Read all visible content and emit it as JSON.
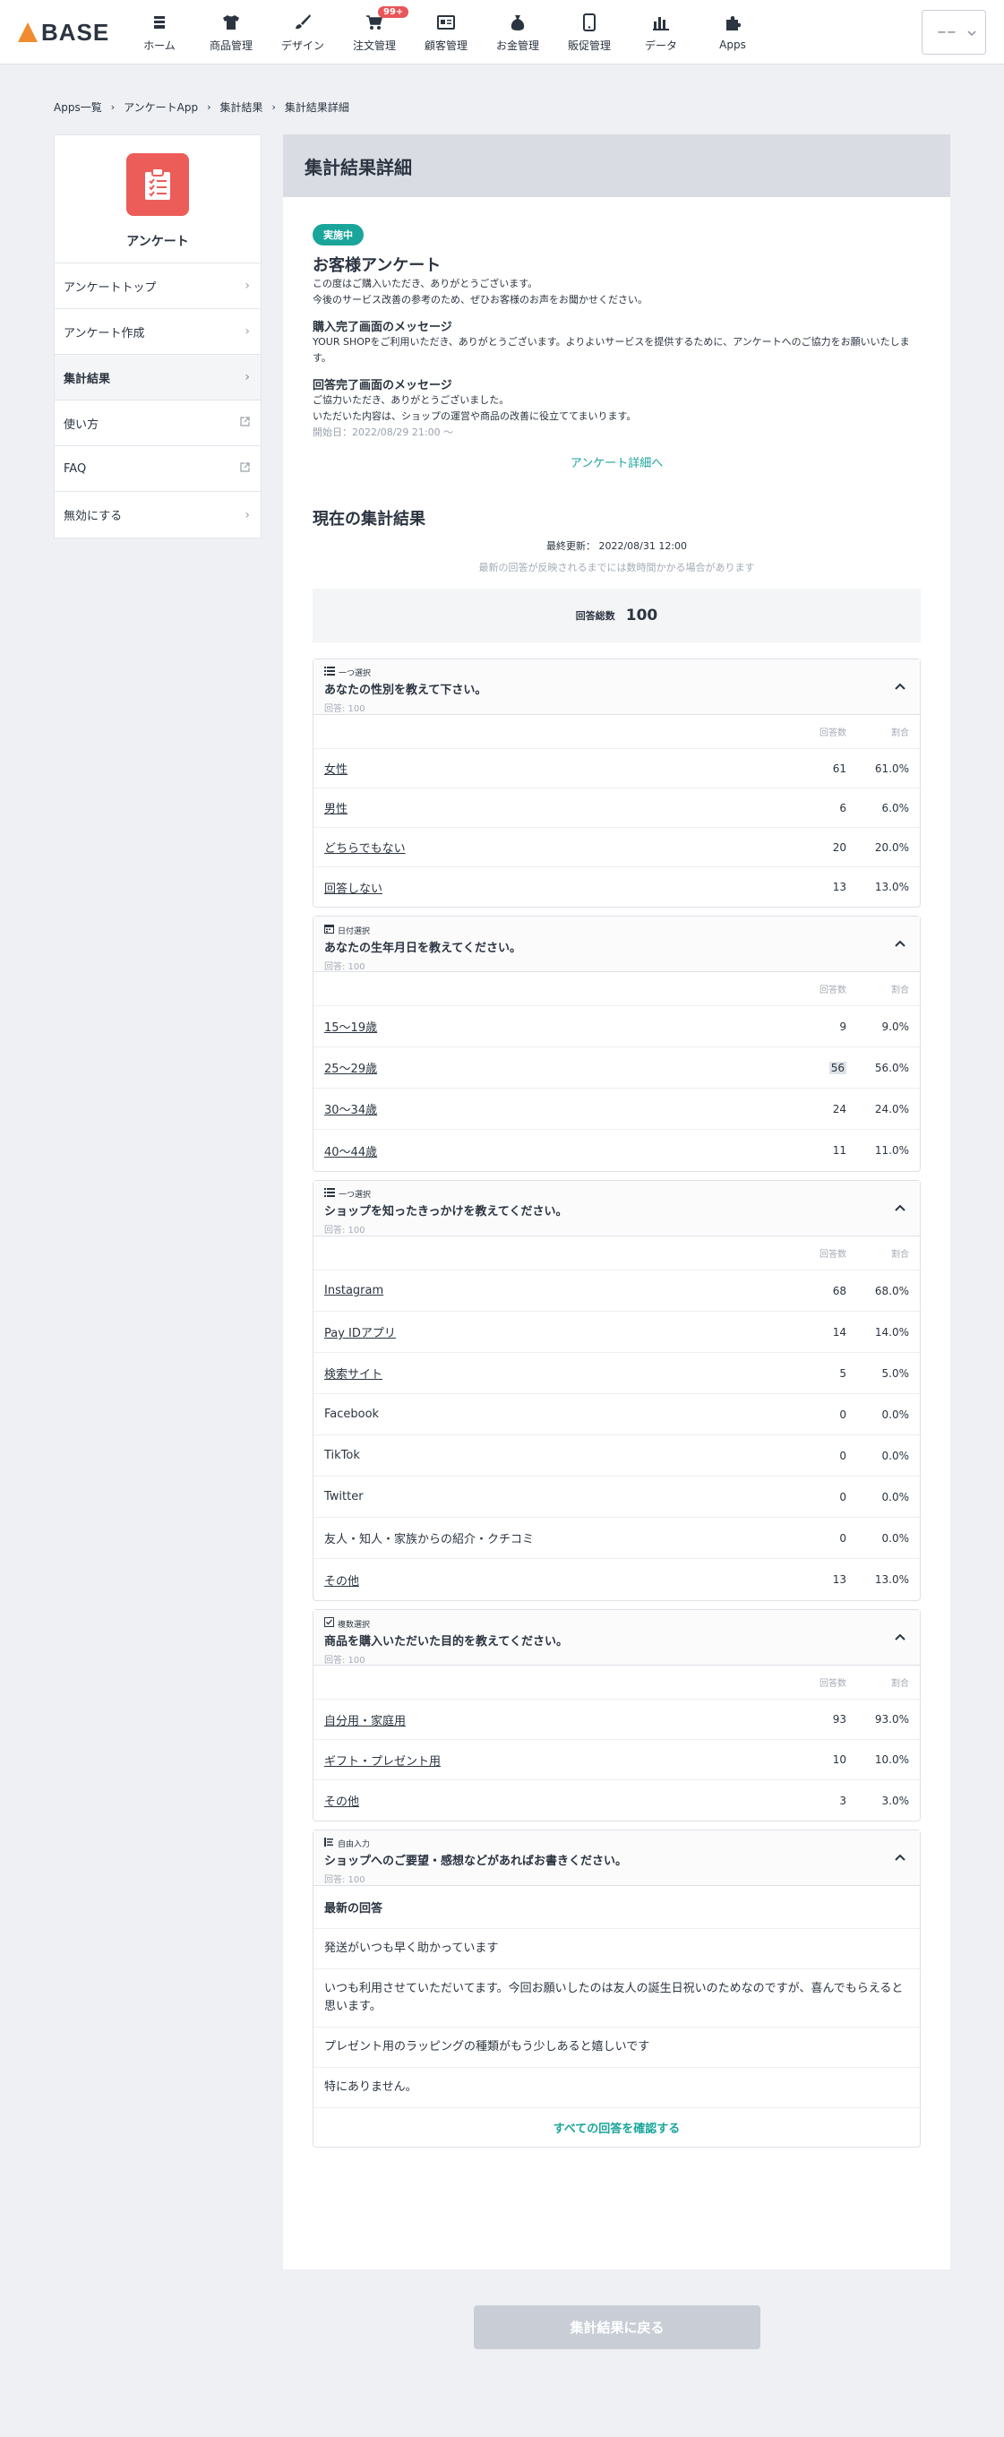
{
  "header": {
    "logo": "BASE",
    "nav": [
      {
        "label": "ホーム",
        "icon": "home-icon"
      },
      {
        "label": "商品管理",
        "icon": "shirt-icon"
      },
      {
        "label": "デザイン",
        "icon": "brush-icon"
      },
      {
        "label": "注文管理",
        "icon": "cart-icon",
        "badge": "99+"
      },
      {
        "label": "顧客管理",
        "icon": "customer-card-icon"
      },
      {
        "label": "お金管理",
        "icon": "money-bag-icon"
      },
      {
        "label": "販促管理",
        "icon": "smartphone-icon"
      },
      {
        "label": "データ",
        "icon": "bar-chart-icon"
      },
      {
        "label": "Apps",
        "icon": "puzzle-icon"
      }
    ],
    "shop_select": "−−"
  },
  "breadcrumb": [
    "Apps一覧",
    "アンケートApp",
    "集計結果",
    "集計結果詳細"
  ],
  "sidebar": {
    "title": "アンケート",
    "items": [
      {
        "label": "アンケートトップ",
        "icon": "chevron-right-icon"
      },
      {
        "label": "アンケート作成",
        "icon": "chevron-right-icon"
      },
      {
        "label": "集計結果",
        "icon": "chevron-right-icon",
        "active": true
      },
      {
        "label": "使い方",
        "icon": "external-link-icon"
      },
      {
        "label": "FAQ",
        "icon": "external-link-icon"
      },
      {
        "label": "無効にする",
        "icon": "chevron-right-icon"
      }
    ]
  },
  "main": {
    "heading": "集計結果詳細",
    "status": "実施中",
    "survey_title": "お客様アンケート",
    "intro_1": "この度はご購入いただき、ありがとうございます。",
    "intro_2": "今後のサービス改善の参考のため、ぜひお客様のお声をお聞かせください。",
    "purchase_msg_title": "購入完了画面のメッセージ",
    "purchase_msg": "YOUR SHOPをご利用いただき、ありがとうございます。よりよいサービスを提供するために、アンケートへのご協力をお願いいたします。",
    "answer_msg_title": "回答完了画面のメッセージ",
    "answer_msg_1": "ご協力いただき、ありがとうございました。",
    "answer_msg_2": "いただいた内容は、ショップの運営や商品の改善に役立ててまいります。",
    "start_date": "開始日：2022/08/29 21:00 〜",
    "detail_link": "アンケート詳細へ",
    "results_title": "現在の集計結果",
    "last_updated": "最終更新： 2022/08/31 12:00",
    "lag_note": "最新の回答が反映されるまでには数時間かかる場合があります",
    "total_label": "回答総数",
    "total_value": "100",
    "col_count": "回答数",
    "col_ratio": "割合",
    "all_answers_link": "すべての回答を確認する",
    "latest_answers_label": "最新の回答"
  },
  "questions": [
    {
      "type": "一つ選択",
      "type_icon": "list-icon",
      "title": "あなたの性別を教えて下さい。",
      "count": "回答: 100",
      "rows": [
        {
          "label": "女性",
          "n": "61",
          "pct": "61.0%",
          "link": true
        },
        {
          "label": "男性",
          "n": "6",
          "pct": "6.0%",
          "link": true
        },
        {
          "label": "どちらでもない",
          "n": "20",
          "pct": "20.0%",
          "link": true
        },
        {
          "label": "回答しない",
          "n": "13",
          "pct": "13.0%",
          "link": true
        }
      ]
    },
    {
      "type": "日付選択",
      "type_icon": "calendar-icon",
      "title": "あなたの生年月日を教えてください。",
      "count": "回答: 100",
      "rows": [
        {
          "label": "15〜19歳",
          "n": "9",
          "pct": "9.0%",
          "link": true
        },
        {
          "label": "25〜29歳",
          "n": "56",
          "pct": "56.0%",
          "link": true,
          "hl": true
        },
        {
          "label": "30〜34歳",
          "n": "24",
          "pct": "24.0%",
          "link": true
        },
        {
          "label": "40〜44歳",
          "n": "11",
          "pct": "11.0%",
          "link": true
        }
      ]
    },
    {
      "type": "一つ選択",
      "type_icon": "list-icon",
      "title": "ショップを知ったきっかけを教えてください。",
      "count": "回答: 100",
      "rows": [
        {
          "label": "Instagram",
          "n": "68",
          "pct": "68.0%",
          "link": true
        },
        {
          "label": "Pay IDアプリ",
          "n": "14",
          "pct": "14.0%",
          "link": true
        },
        {
          "label": "検索サイト",
          "n": "5",
          "pct": "5.0%",
          "link": true
        },
        {
          "label": "Facebook",
          "n": "0",
          "pct": "0.0%",
          "link": false
        },
        {
          "label": "TikTok",
          "n": "0",
          "pct": "0.0%",
          "link": false
        },
        {
          "label": "Twitter",
          "n": "0",
          "pct": "0.0%",
          "link": false
        },
        {
          "label": "友人・知人・家族からの紹介・クチコミ",
          "n": "0",
          "pct": "0.0%",
          "link": false
        },
        {
          "label": "その他",
          "n": "13",
          "pct": "13.0%",
          "link": true
        }
      ]
    },
    {
      "type": "複数選択",
      "type_icon": "checkbox-icon",
      "title": "商品を購入いただいた目的を教えてください。",
      "count": "回答: 100",
      "rows": [
        {
          "label": "自分用・家庭用",
          "n": "93",
          "pct": "93.0%",
          "link": true
        },
        {
          "label": "ギフト・プレゼント用",
          "n": "10",
          "pct": "10.0%",
          "link": true
        },
        {
          "label": "その他",
          "n": "3",
          "pct": "3.0%",
          "link": true
        }
      ]
    }
  ],
  "free_question": {
    "type": "自由入力",
    "type_icon": "text-icon",
    "title": "ショップへのご要望・感想などがあればお書きください。",
    "count": "回答: 100",
    "answers": [
      "発送がいつも早く助かっています",
      "いつも利用させていただいてます。今回お願いしたのは友人の誕生日祝いのためなのですが、喜んでもらえると思います。",
      "プレゼント用のラッピングの種類がもう少しあると嬉しいです",
      "特にありません。"
    ]
  },
  "footer": {
    "back_button": "集計結果に戻る"
  },
  "colors": {
    "accent": "#1aa59a",
    "app_icon": "#ec5d5a",
    "badge": "#e8565a"
  }
}
